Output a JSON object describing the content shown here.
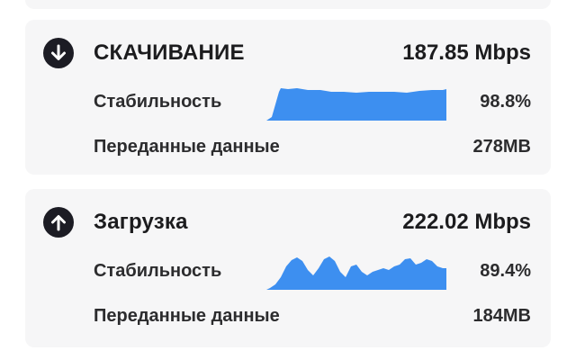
{
  "download": {
    "title": "СКАЧИВАНИЕ",
    "speed": "187.85 Mbps",
    "stability_label": "Стабильность",
    "stability_value": "98.8%",
    "stability_fraction": 0.988,
    "data_label": "Переданные данные",
    "data_value": "278MB",
    "icon": "arrow-down-circle-icon"
  },
  "upload": {
    "title": "Загрузка",
    "speed": "222.02 Mbps",
    "stability_label": "Стабильность",
    "stability_value": "89.4%",
    "stability_fraction": 0.894,
    "data_label": "Переданные данные",
    "data_value": "184MB",
    "icon": "arrow-up-circle-icon"
  },
  "colors": {
    "accent": "#3d8ff0",
    "icon_bg": "#1c1c24",
    "card_bg": "#f6f6f7"
  }
}
